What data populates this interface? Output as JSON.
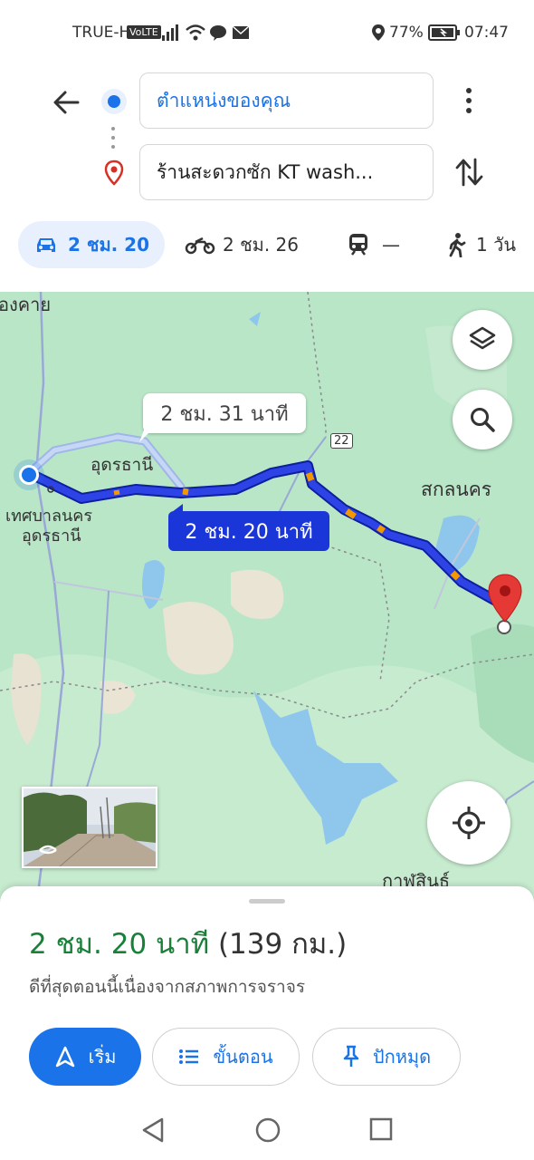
{
  "status_bar": {
    "carrier": "TRUE-H",
    "volte": "VoLTE",
    "battery": "77%",
    "time": "07:47"
  },
  "directions": {
    "origin": "ตำแหน่งของคุณ",
    "destination": "ร้านสะดวกซัก KT wash..."
  },
  "modes": [
    {
      "name": "car",
      "label": "2 ชม. 20",
      "selected": true
    },
    {
      "name": "motorbike",
      "label": "2 ชม. 26"
    },
    {
      "name": "transit",
      "label": "—"
    },
    {
      "name": "walk",
      "label": "1 วัน"
    }
  ],
  "map": {
    "labels": {
      "nong_khai": "องคาย",
      "udon": "อุดรธานี",
      "tessaban": "เทศบาลนคร",
      "tessaban2": "อุดรธานี",
      "sakon": "สกลนคร",
      "kalasin": "กาฬสินธุ์",
      "road22": "22"
    },
    "alt_route_time": "2 ชม. 31 นาที",
    "main_route_time": "2 ชม. 20 นาที"
  },
  "summary": {
    "time": "2 ชม. 20 นาที",
    "distance": "(139 กม.)",
    "note": "ดีที่สุดตอนนี้เนื่องจากสภาพการจราจร"
  },
  "actions": {
    "start": "เริ่ม",
    "steps": "ขั้นตอน",
    "pin": "ปักหมุด"
  },
  "colors": {
    "accent": "#1a73e8",
    "route": "#1a35d8",
    "green_text": "#188038",
    "map_bg": "#b9e6c7",
    "pin": "#e53935"
  }
}
